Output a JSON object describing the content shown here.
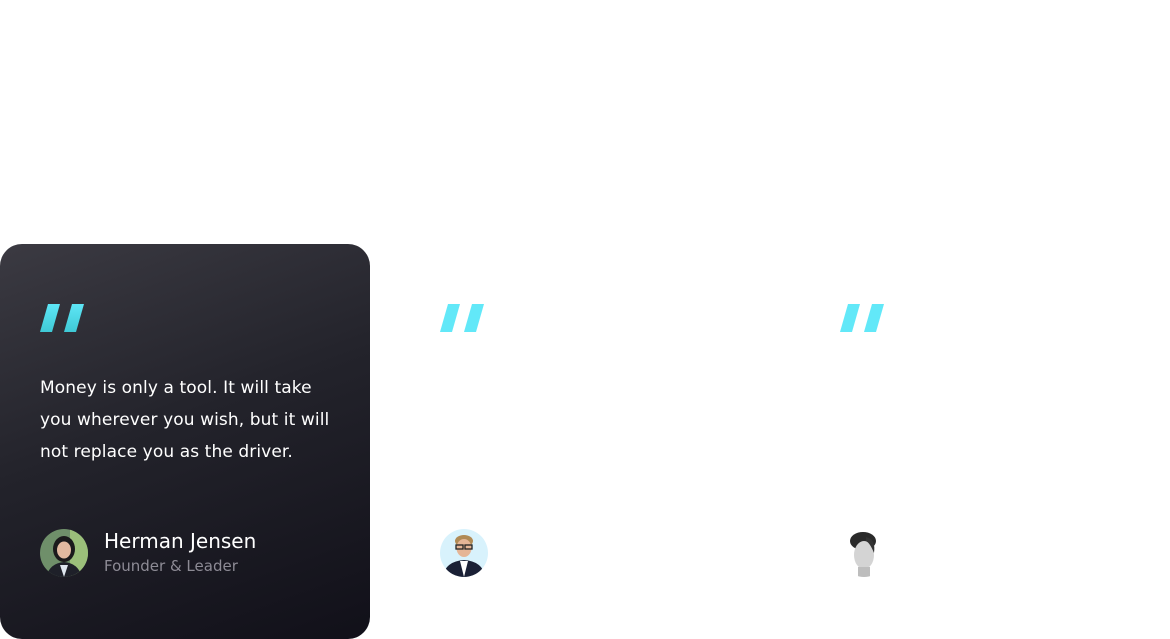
{
  "accent": "#5ee6f6",
  "testimonials": [
    {
      "quote": "Money is only a tool. It will take you wherever you wish, but it will not replace you as the driver.",
      "name": "Herman Jensen",
      "role": "Founder & Leader",
      "avatar": "woman-portrait"
    },
    {
      "quote": "",
      "name": "",
      "role": "",
      "avatar": "man-glasses-portrait"
    },
    {
      "quote": "",
      "name": "",
      "role": "",
      "avatar": "man-bw-portrait"
    }
  ]
}
